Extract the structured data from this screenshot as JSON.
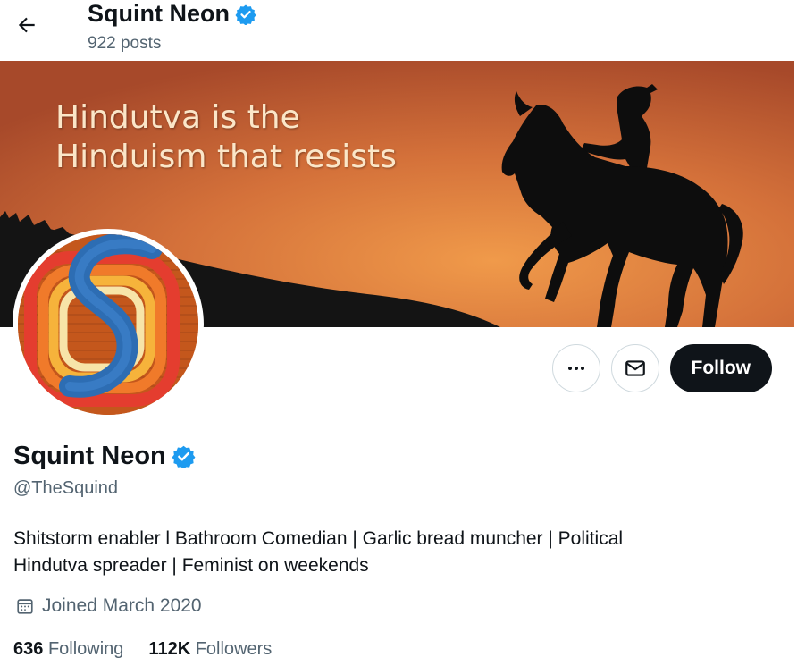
{
  "header": {
    "display_name": "Squint Neon",
    "post_count": "922 posts"
  },
  "banner": {
    "line1": "Hindutva is the",
    "line2": "Hinduism that resists"
  },
  "actions": {
    "follow_label": "Follow"
  },
  "profile": {
    "display_name": "Squint Neon",
    "handle": "@TheSquind",
    "bio_line1": "Shitstorm enabler l Bathroom Comedian | Garlic bread muncher | Political",
    "bio_line2": "Hindutva spreader | Feminist on weekends",
    "joined": "Joined March 2020"
  },
  "stats": {
    "following_count": "636",
    "following_label": "Following",
    "followers_count": "112K",
    "followers_label": "Followers"
  },
  "colors": {
    "verified": "#1d9bf0",
    "secondary_text": "#536471",
    "follow_button": "#0f1419"
  },
  "icons": [
    "back-arrow-icon",
    "verified-badge-icon",
    "more-icon",
    "mail-icon",
    "calendar-icon"
  ]
}
